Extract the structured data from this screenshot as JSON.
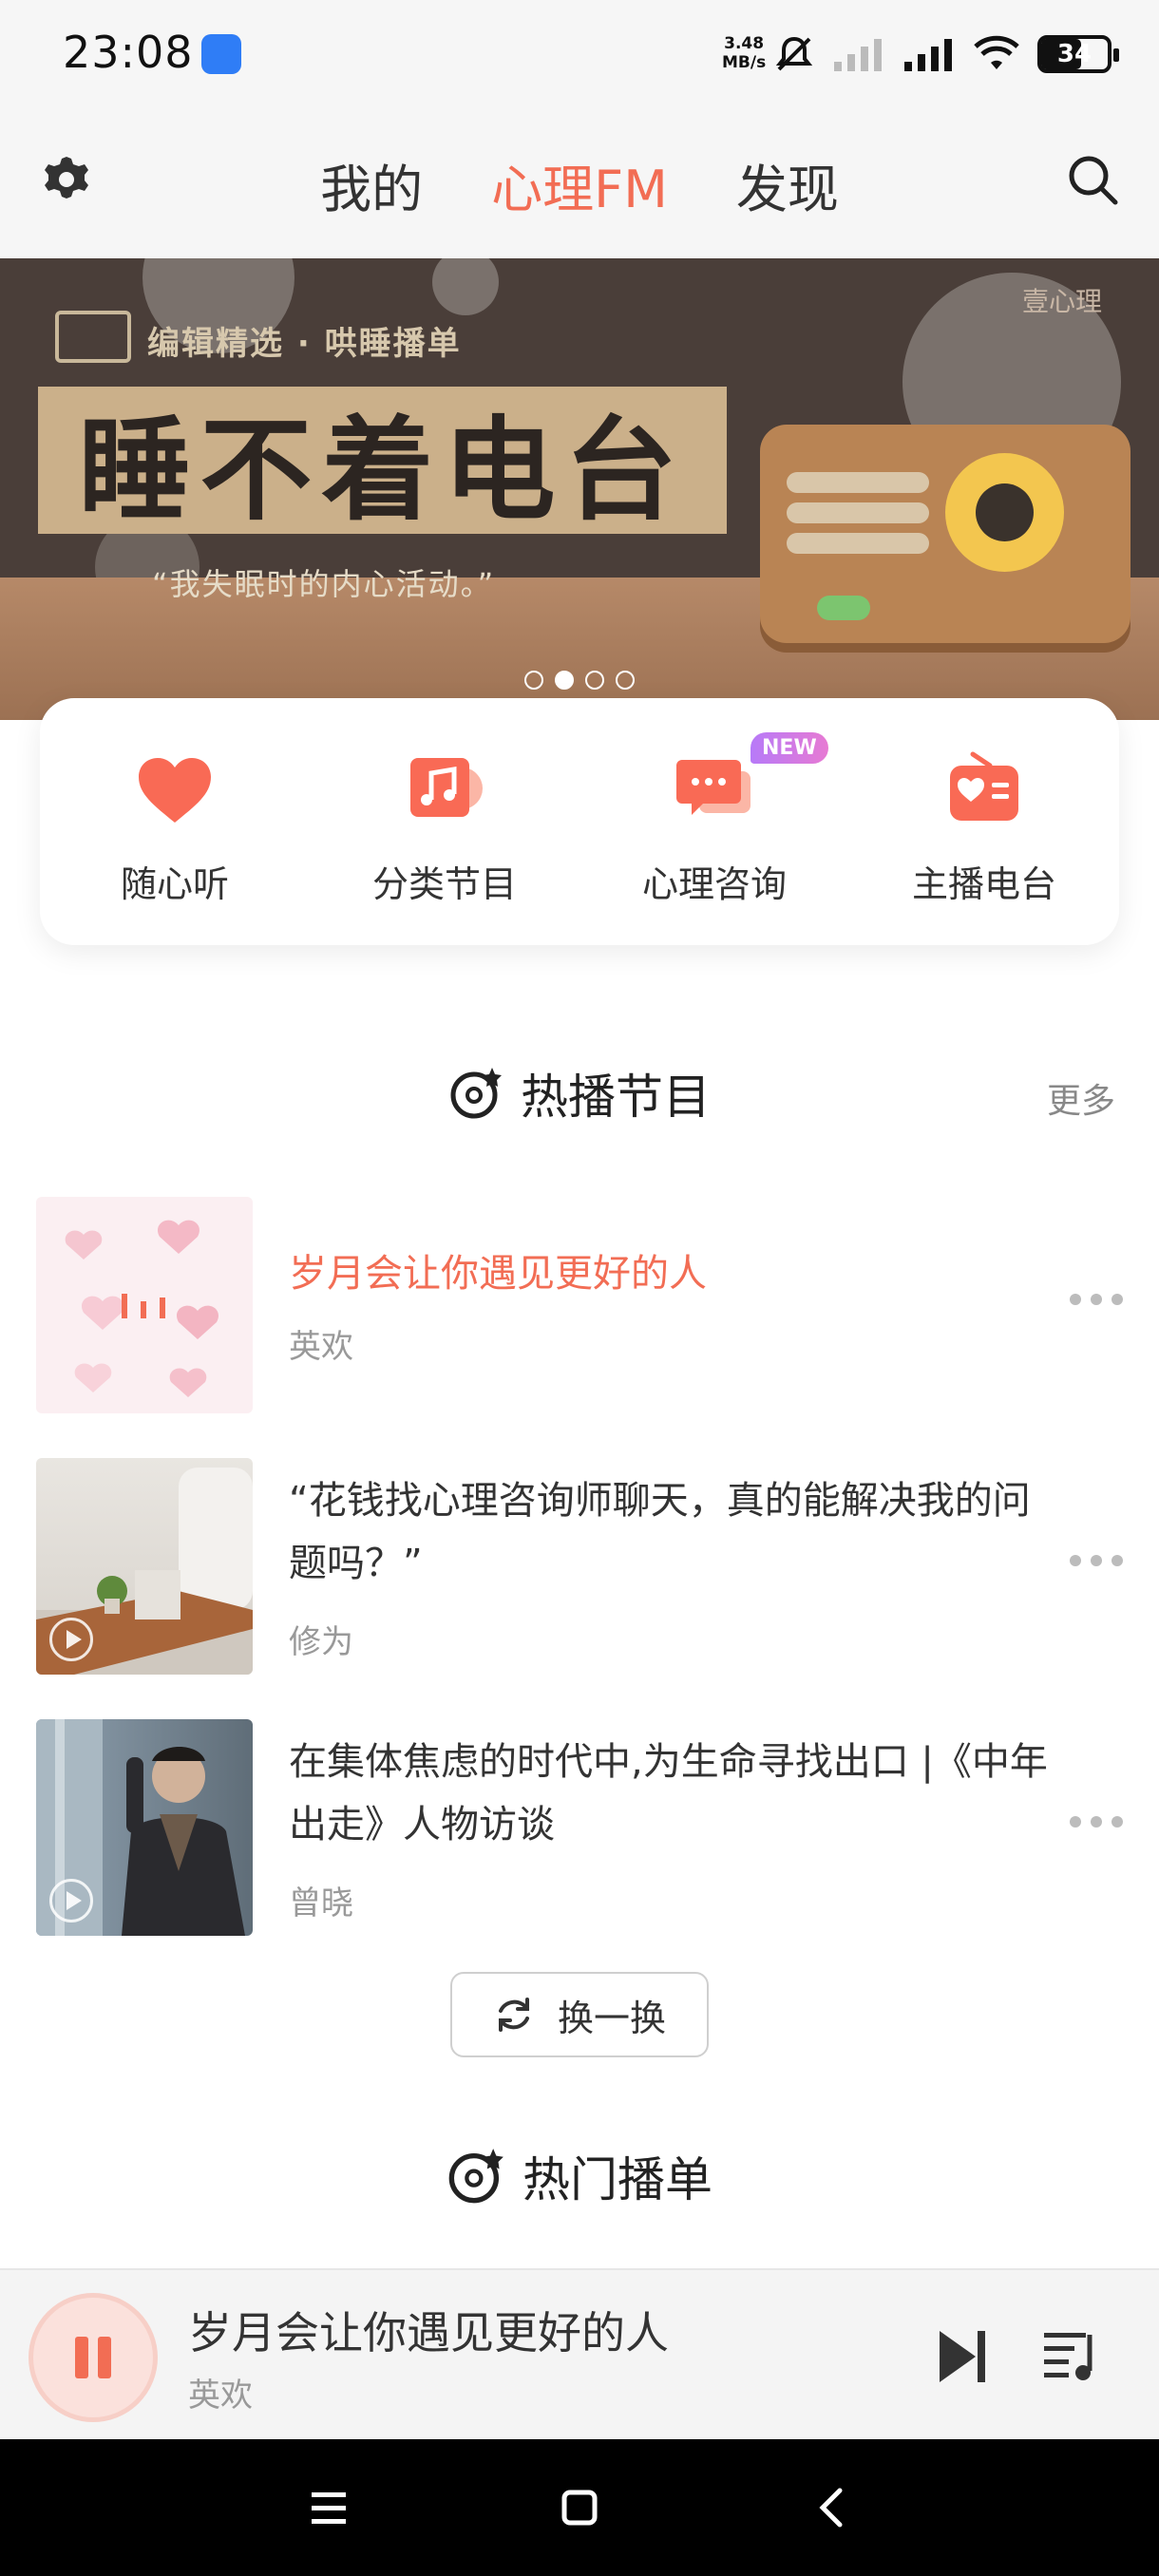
{
  "status_bar": {
    "time": "23:08",
    "net_speed": "3.48",
    "net_unit": "MB/s",
    "battery": "34"
  },
  "header": {
    "tabs": [
      {
        "label": "我的",
        "active": false
      },
      {
        "label": "心理FM",
        "active": true
      },
      {
        "label": "发现",
        "active": false
      }
    ],
    "accent_color": "#f26d54"
  },
  "banner": {
    "subtitle": "编辑精选 · 哄睡播单",
    "title": "睡不着电台",
    "quote": "“我失眠时的内心活动。”",
    "brand": "壹心理",
    "pages": 4,
    "active_page": 2
  },
  "quick_nav": {
    "items": [
      {
        "label": "随心听",
        "icon": "heart-icon"
      },
      {
        "label": "分类节目",
        "icon": "music-note-icon"
      },
      {
        "label": "心理咨询",
        "icon": "chat-bubbles-icon",
        "badge": "NEW"
      },
      {
        "label": "主播电台",
        "icon": "radio-icon"
      }
    ]
  },
  "hot_programs": {
    "title": "热播节目",
    "more": "更多",
    "items": [
      {
        "title": "岁月会让你遇见更好的人",
        "author": "英欢",
        "playing": true
      },
      {
        "title": "“花钱找心理咨询师聊天，真的能解决我的问题吗？”",
        "author": "修为",
        "playing": false
      },
      {
        "title": "在集体焦虑的时代中,为生命寻找出口 |《中年出走》人物访谈",
        "author": "曾晓",
        "playing": false
      }
    ],
    "refresh_label": "换一换"
  },
  "hot_playlists": {
    "title": "热门播单"
  },
  "mini_player": {
    "title": "岁月会让你遇见更好的人",
    "author": "英欢"
  }
}
